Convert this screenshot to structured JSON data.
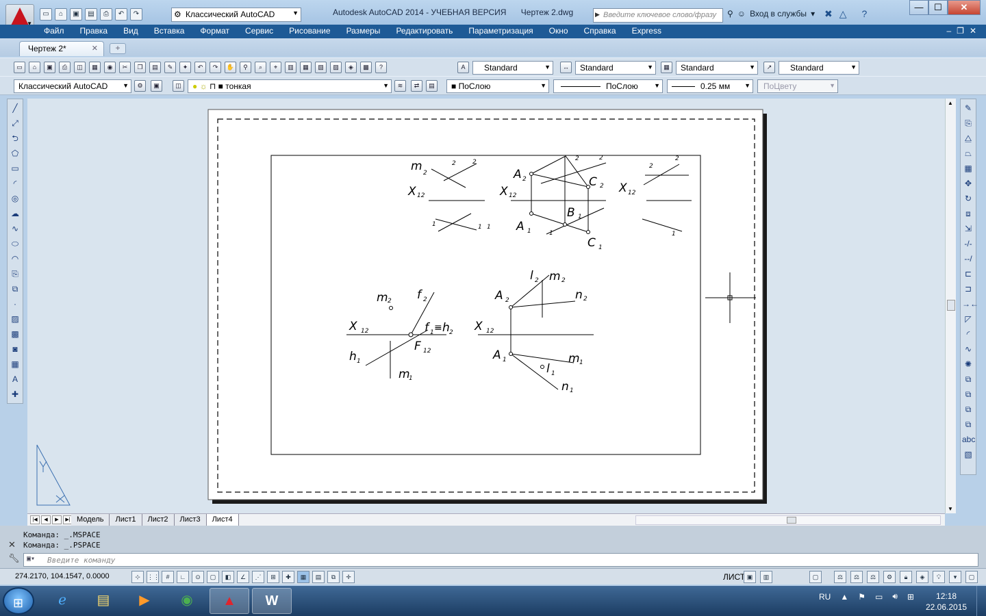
{
  "app": {
    "title": "Autodesk AutoCAD 2014 - УЧЕБНАЯ ВЕРСИЯ",
    "filename": "Чертеж 2.dwg",
    "workspace": "Классический AutoCAD",
    "search_placeholder": "Введите ключевое слово/фразу",
    "login": "Вход в службы"
  },
  "menu": [
    "Файл",
    "Правка",
    "Вид",
    "Вставка",
    "Формат",
    "Сервис",
    "Рисование",
    "Размеры",
    "Редактировать",
    "Параметризация",
    "Окно",
    "Справка",
    "Express"
  ],
  "doc_tab": "Чертеж 2*",
  "styles": {
    "text_style": "Standard",
    "dim_style": "Standard",
    "table_style": "Standard",
    "mleader_style": "Standard"
  },
  "props": {
    "workspace": "Классический AutoCAD",
    "layer": "тонкая",
    "color": "ПоСлою",
    "linetype": "ПоСлою",
    "lineweight": "0.25 мм",
    "plotstyle": "ПоЦвету"
  },
  "layout_tabs": [
    "Модель",
    "Лист1",
    "Лист2",
    "Лист3",
    "Лист4"
  ],
  "command": {
    "history": [
      "Команда:  _.MSPACE",
      "Команда:  _.PSPACE"
    ],
    "placeholder": "Введите  команду"
  },
  "status": {
    "coords": "274.2170, 104.1547, 0.0000",
    "space": "ЛИСТ"
  },
  "drawing_labels": {
    "m2": "m",
    "sub2": "2",
    "sub1": "1",
    "x": "X",
    "sub12": "12",
    "A": "A",
    "B": "B",
    "C": "C",
    "f": "f",
    "h": "h",
    "F": "F",
    "l": "l",
    "n": "n",
    "m": "m",
    "equiv": "≡",
    "one": "1",
    "two": "2"
  },
  "taskbar": {
    "lang": "RU",
    "time": "12:18",
    "date": "22.06.2015"
  },
  "colors": {
    "menubar": "#1e5a96",
    "canvas": "#d9e4ee",
    "paper": "#ffffff"
  }
}
